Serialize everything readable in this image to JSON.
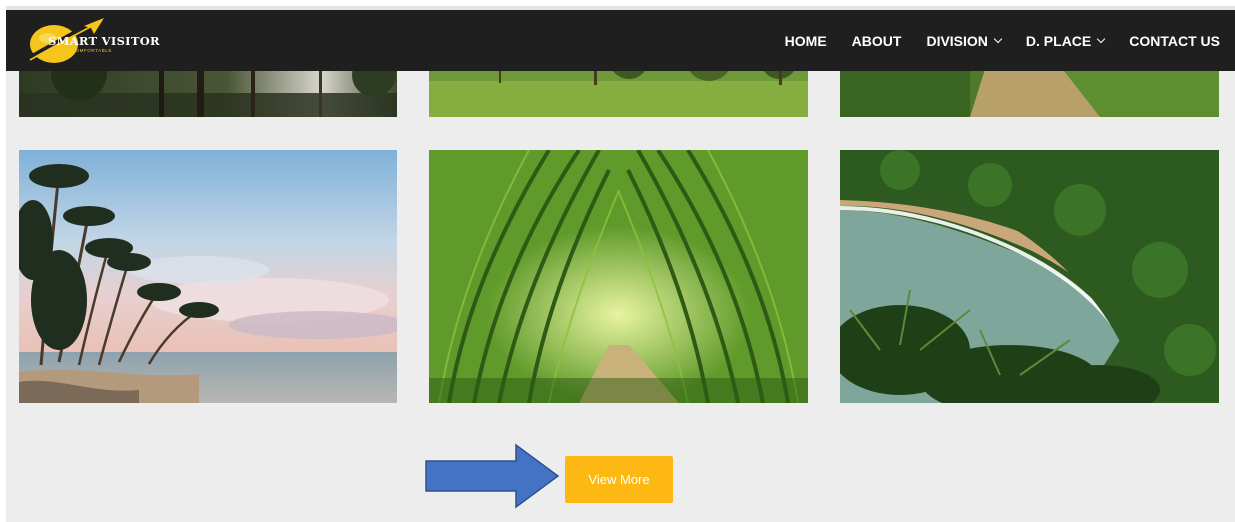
{
  "brand": {
    "name": "SMART VISITOR",
    "tagline": "EASY & COMFORTABLE",
    "accent_color": "#f5c51b"
  },
  "nav": {
    "items": [
      {
        "label": "HOME",
        "has_dropdown": false
      },
      {
        "label": "ABOUT",
        "has_dropdown": false
      },
      {
        "label": "DIVISION",
        "has_dropdown": true
      },
      {
        "label": "D. PLACE",
        "has_dropdown": true
      },
      {
        "label": "CONTACT US",
        "has_dropdown": false
      }
    ],
    "background": "#1f1f1f"
  },
  "gallery": {
    "photos": [
      {
        "scene": "forest-trees"
      },
      {
        "scene": "grassy-riverbank"
      },
      {
        "scene": "forest-path"
      },
      {
        "scene": "palm-beach-sunset"
      },
      {
        "scene": "bamboo-tunnel"
      },
      {
        "scene": "tropical-cove"
      }
    ]
  },
  "cta": {
    "label": "View More",
    "color": "#fdb813"
  },
  "annotation": {
    "icon": "arrow-right-icon",
    "color": "#4472c4"
  }
}
